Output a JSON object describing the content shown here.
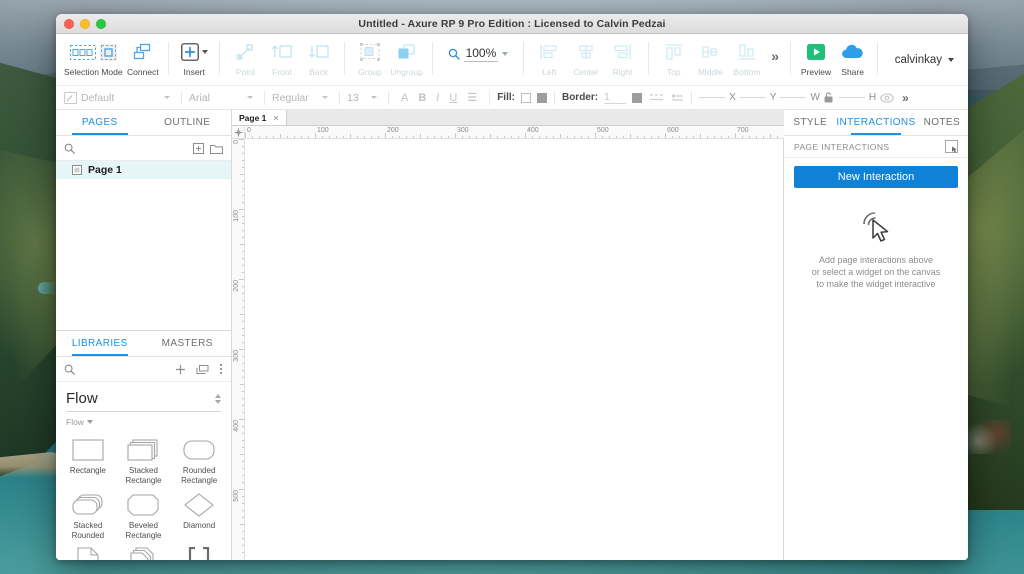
{
  "window": {
    "title": "Untitled - Axure RP 9 Pro Edition : Licensed to Calvin Pedzai"
  },
  "toolbar": {
    "selection_mode_label": "Selection Mode",
    "connect_label": "Connect",
    "insert_label": "Insert",
    "point_label": "Point",
    "front_label": "Front",
    "back_label": "Back",
    "group_label": "Group",
    "ungroup_label": "Ungroup",
    "zoom_value": "100%",
    "align_left_label": "Left",
    "align_center_label": "Center",
    "align_right_label": "Right",
    "align_top_label": "Top",
    "align_middle_label": "Middle",
    "align_bottom_label": "Bottom",
    "overflow_label": "»",
    "preview_label": "Preview",
    "share_label": "Share",
    "user_name": "calvinkay",
    "accent_blue": "#0f82d8",
    "preview_green": "#1ec07a",
    "share_blue": "#2f9ee8"
  },
  "format_bar": {
    "style_value": "Default",
    "font_family": "Arial",
    "font_weight": "Regular",
    "font_size": "13",
    "color_label": "A",
    "bold_label": "B",
    "italic_label": "I",
    "underline_label": "U",
    "list_label": "☰",
    "fill_label": "Fill:",
    "border_label": "Border:",
    "border_width": "1",
    "x_label": "X",
    "y_label": "Y",
    "w_label": "W",
    "h_label": "H",
    "overflow_label": "»"
  },
  "left_panel": {
    "tabs": [
      {
        "label": "PAGES",
        "active": true
      },
      {
        "label": "OUTLINE",
        "active": false
      }
    ],
    "search_placeholder": "",
    "pages": [
      {
        "label": "Page 1",
        "selected": true
      }
    ]
  },
  "libraries_panel": {
    "tabs": [
      {
        "label": "LIBRARIES",
        "active": true
      },
      {
        "label": "MASTERS",
        "active": false
      }
    ],
    "selected_library": "Flow",
    "group_label": "Flow",
    "widgets": [
      {
        "name": "Rectangle",
        "shape": "rectangle"
      },
      {
        "name": "Stacked Rectangle",
        "shape": "stacked-rectangle"
      },
      {
        "name": "Rounded Rectangle",
        "shape": "rounded-rectangle"
      },
      {
        "name": "Stacked Rounded",
        "shape": "stacked-rounded"
      },
      {
        "name": "Beveled Rectangle",
        "shape": "beveled-rectangle"
      },
      {
        "name": "Diamond",
        "shape": "diamond"
      },
      {
        "name": "",
        "shape": "file"
      },
      {
        "name": "",
        "shape": "stacked-file"
      },
      {
        "name": "",
        "shape": "brackets"
      }
    ]
  },
  "canvas": {
    "page_tab_label": "Page 1",
    "close_glyph": "×",
    "ruler_h_labels": [
      "0",
      "100",
      "200",
      "300",
      "400",
      "500",
      "600",
      "700"
    ],
    "ruler_v_labels": [
      "0",
      "100",
      "200",
      "300",
      "400",
      "500"
    ]
  },
  "right_panel": {
    "tabs": [
      {
        "label": "STYLE",
        "active": false
      },
      {
        "label": "INTERACTIONS",
        "active": true
      },
      {
        "label": "NOTES",
        "active": false
      }
    ],
    "section_title": "PAGE INTERACTIONS",
    "new_interaction_label": "New Interaction",
    "empty_line1": "Add page interactions above",
    "empty_line2": "or select a widget on the canvas",
    "empty_line3": "to make the widget interactive"
  }
}
